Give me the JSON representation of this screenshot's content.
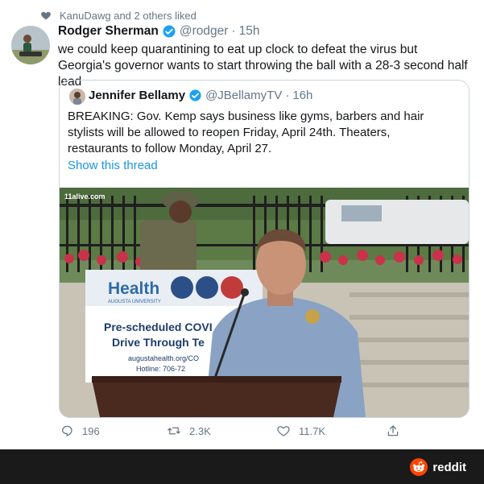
{
  "social_context": {
    "text": "KanuDawg and 2 others liked",
    "icon": "heart-icon"
  },
  "tweet": {
    "author_name": "Rodger Sherman",
    "handle": "@rodger",
    "separator": "·",
    "time": "15h",
    "text": "we could keep quarantining to eat up clock to defeat the virus but Georgia's governor wants to start throwing the ball with a 28-3 second half lead",
    "verified": true
  },
  "quoted_tweet": {
    "author_name": "Jennifer Bellamy",
    "handle": "@JBellamyTV",
    "separator": "·",
    "time": "16h",
    "text": "BREAKING: Gov. Kemp says business like gyms, barbers and hair stylists will be allowed to reopen Friday, April 24th. Theaters, restaurants to follow Monday, April 27.",
    "thread_link": "Show this thread",
    "media": {
      "watermark": "11alive.com",
      "sign_brand": "Health",
      "sign_brand_sub": "AUGUSTA UNIVERSITY",
      "sign_line1": "Pre-scheduled COVI",
      "sign_line2": "Drive Through Te",
      "sign_url": "augustahealth.org/CO",
      "sign_hotline": "Hotline: 706-72"
    }
  },
  "actions": {
    "reply_count": "196",
    "retweet_count": "2.3K",
    "like_count": "11.7K"
  },
  "footer": {
    "brand": "reddit"
  },
  "colors": {
    "link": "#1b95e0",
    "muted": "#657786",
    "verified": "#1da1f2",
    "footer_bg": "#1a1a1b",
    "reddit_orange": "#ff4500"
  }
}
